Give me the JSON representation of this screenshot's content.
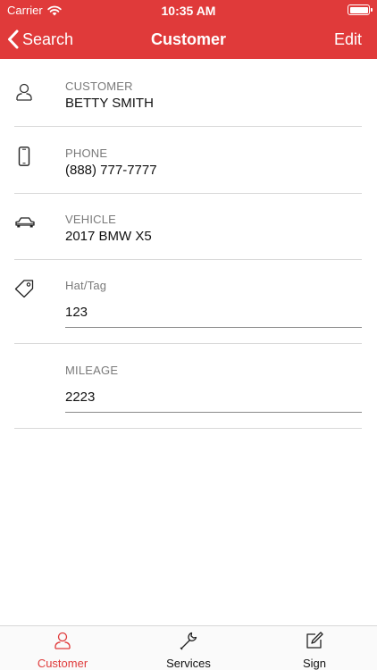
{
  "status_bar": {
    "carrier": "Carrier",
    "time": "10:35 AM"
  },
  "nav": {
    "back_label": "Search",
    "title": "Customer",
    "edit_label": "Edit"
  },
  "fields": {
    "customer": {
      "label": "CUSTOMER",
      "value": "BETTY SMITH",
      "icon": "person-icon"
    },
    "phone": {
      "label": "PHONE",
      "value": "(888) 777-7777",
      "icon": "phone-icon"
    },
    "vehicle": {
      "label": "VEHICLE",
      "value": "2017 BMW X5",
      "icon": "car-icon"
    },
    "hat_tag": {
      "label": "Hat/Tag",
      "value": "123",
      "icon": "tag-icon"
    },
    "mileage": {
      "label": "MILEAGE",
      "value": "2223"
    }
  },
  "tabs": [
    {
      "label": "Customer",
      "icon": "person-icon",
      "active": true
    },
    {
      "label": "Services",
      "icon": "wrench-icon",
      "active": false
    },
    {
      "label": "Sign",
      "icon": "compose-icon",
      "active": false
    }
  ],
  "colors": {
    "accent": "#e03a3a",
    "divider": "#d9d9d9",
    "label": "#7a7a7a"
  }
}
